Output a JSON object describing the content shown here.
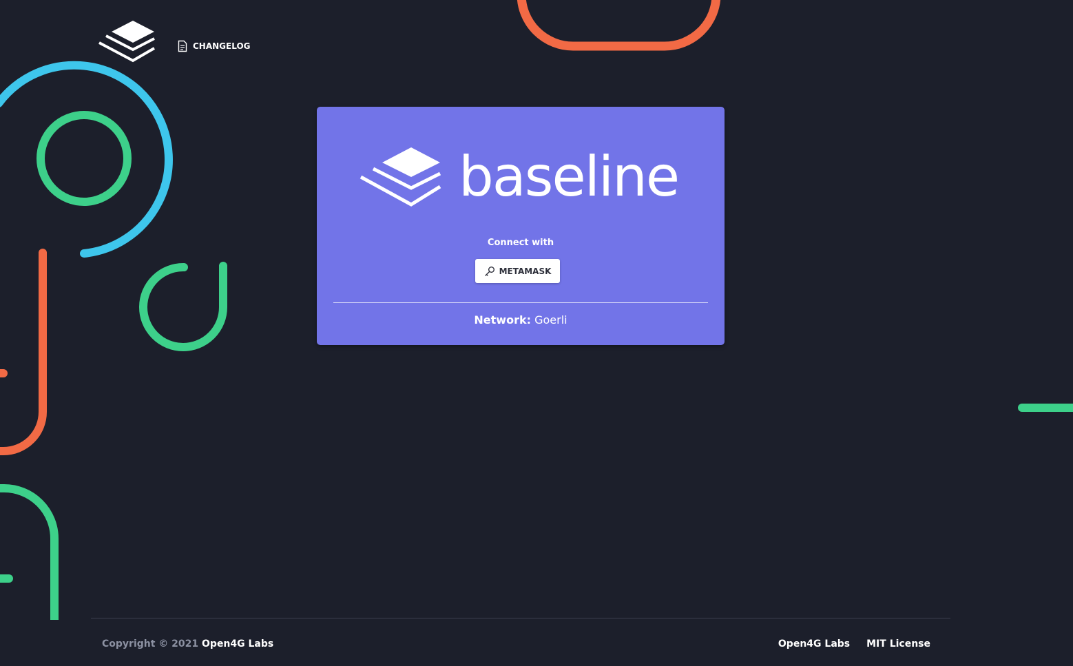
{
  "header": {
    "changelog_label": "CHANGELOG",
    "logo_icon": "baseline-stack-icon",
    "changelog_icon": "document-icon"
  },
  "card": {
    "brand_name": "baseline",
    "connect_label": "Connect with",
    "metamask_label": "METAMASK",
    "metamask_icon": "key-icon",
    "network_label": "Network:",
    "network_value": "Goerli"
  },
  "footer": {
    "copyright": "Copyright © 2021",
    "company": "Open4G Labs",
    "links": [
      "Open4G Labs",
      "MIT License"
    ]
  },
  "colors": {
    "background": "#1c1f2b",
    "card": "#7274e8",
    "blue_accent": "#3ec6ec",
    "green_accent": "#3dd08a",
    "orange_accent": "#f26a45"
  }
}
